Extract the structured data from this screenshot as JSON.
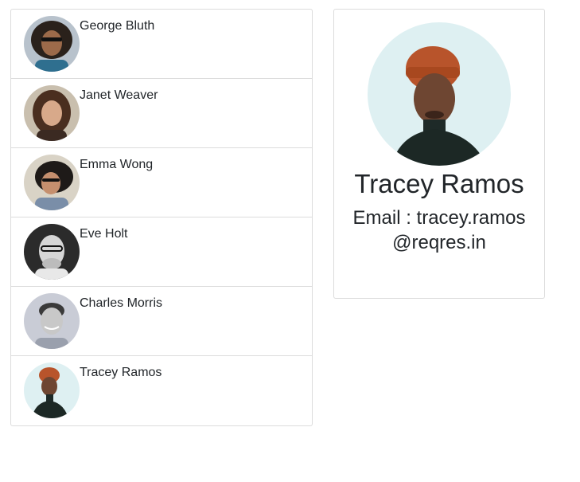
{
  "users": [
    {
      "name": "George Bluth"
    },
    {
      "name": "Janet Weaver"
    },
    {
      "name": "Emma Wong"
    },
    {
      "name": "Eve Holt"
    },
    {
      "name": "Charles Morris"
    },
    {
      "name": "Tracey Ramos"
    }
  ],
  "selected": {
    "name": "Tracey Ramos",
    "email_label": "Email :",
    "email": "tracey.ramos@reqres.in"
  }
}
